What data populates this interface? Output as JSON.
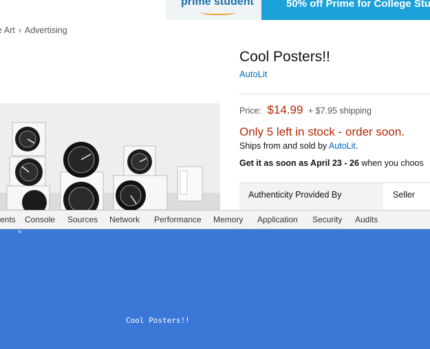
{
  "banner": {
    "prime_logo": "prime student",
    "offer_text": "50% off Prime for College Stude"
  },
  "breadcrumb": [
    "e Art",
    "Advertising"
  ],
  "product": {
    "title": "Cool Posters!!",
    "brand": "AutoLit",
    "price_label": "Price:",
    "price": "$14.99",
    "shipping": "+ $7.95 shipping",
    "stock": "Only 5 left in stock - order soon.",
    "ships_prefix": "Ships from and sold by",
    "ships_seller": "AutoLit",
    "ships_suffix": ".",
    "delivery_prefix": "Get it as soon as April 23 - 26",
    "delivery_suffix": " when you choos",
    "authenticity_label": "Authenticity Provided By",
    "authenticity_value": "Seller"
  },
  "devtools": {
    "tabs": [
      "ents",
      "Console",
      "Sources",
      "Network",
      "Performance",
      "Memory",
      "Application",
      "Security",
      "Audits"
    ],
    "quote_mark": "\"",
    "panel_text": "Cool Posters!!"
  },
  "colors": {
    "price": "#b12704",
    "link": "#0066c0",
    "devtools_panel": "#3b77d6",
    "banner_blue": "#1ba0d8"
  }
}
